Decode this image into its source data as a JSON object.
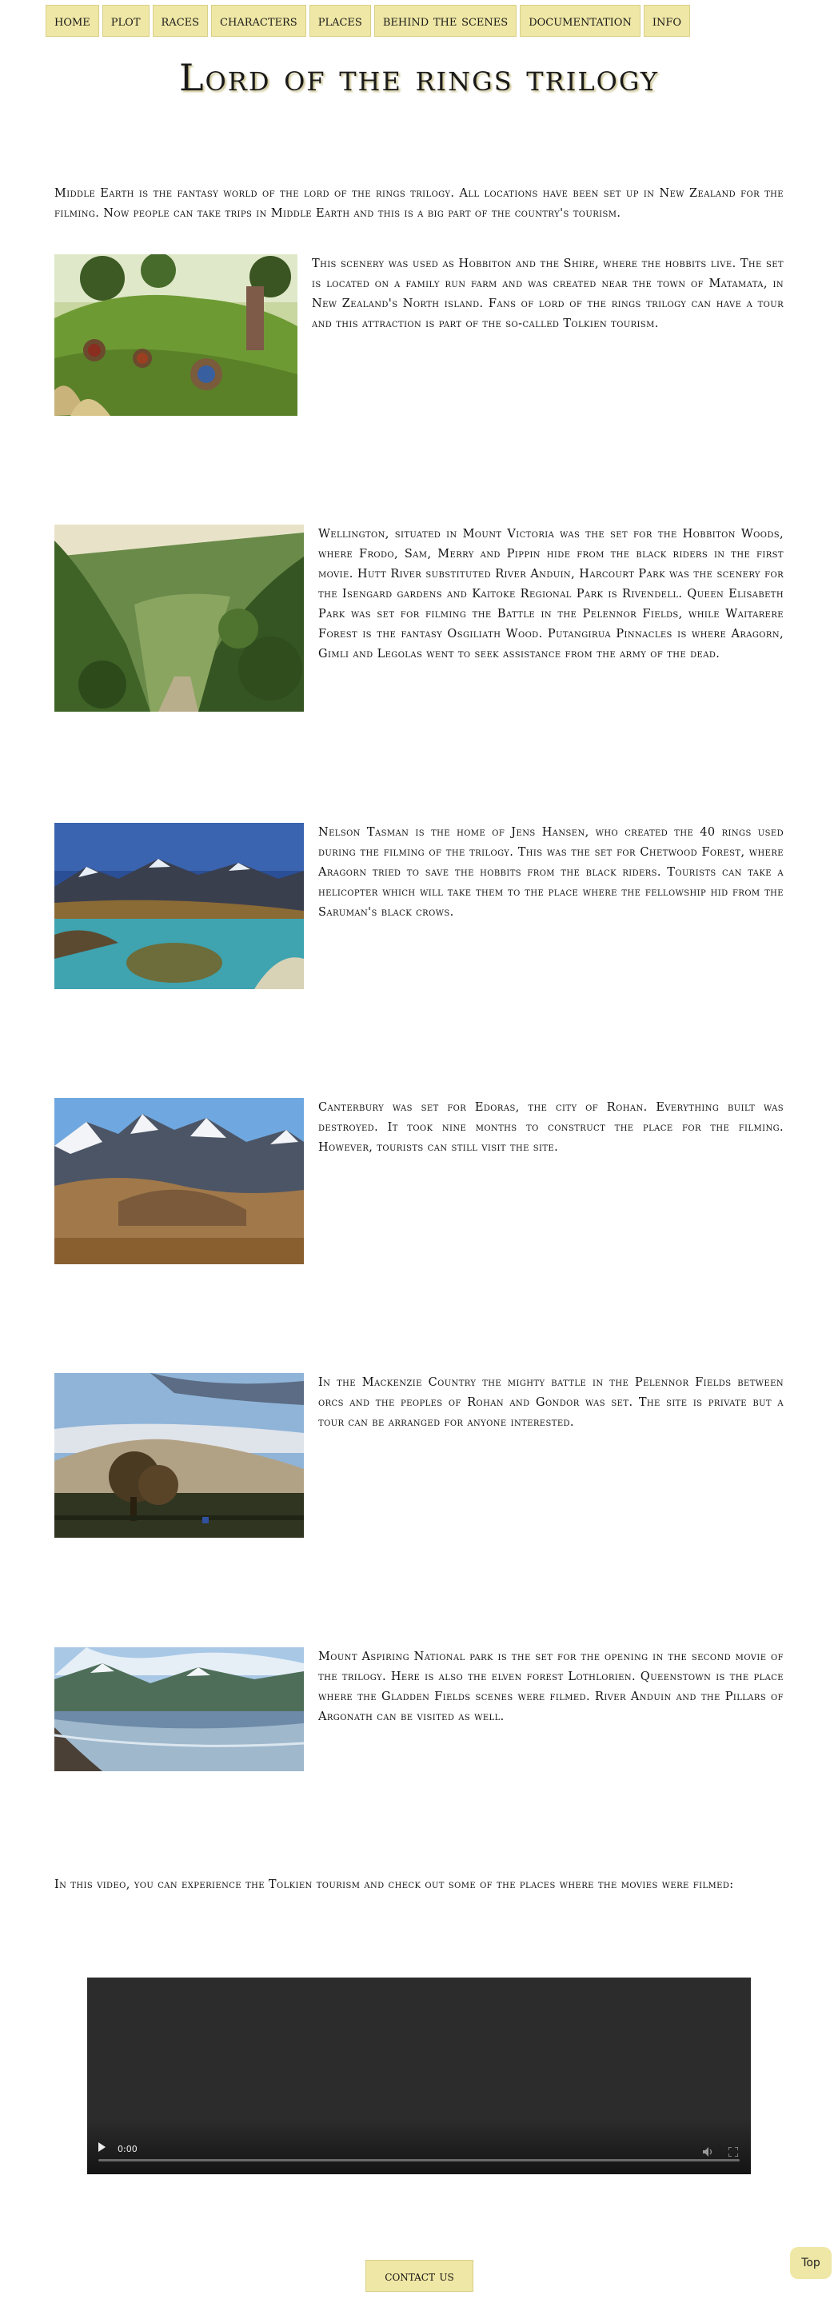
{
  "nav": {
    "items": [
      "home",
      "plot",
      "races",
      "characters",
      "places",
      "behind the scenes",
      "documentation",
      "info"
    ]
  },
  "header": {
    "title": "Lord of the rings trilogy"
  },
  "intro": "Middle Earth is the fantasy world of the lord of the rings trilogy. All locations have been set up in New Zealand for the filming. Now people can take trips in Middle Earth and this is a big part of the country's tourism.",
  "locations": [
    {
      "image": "hobbiton-image",
      "text": "This scenery was used as Hobbiton and the Shire, where the hobbits live. The set is located on a family run farm and was created near the town of Matamata, in New Zealand's North island. Fans of lord of the rings trilogy can have a tour and this attraction is part of the so-called Tolkien tourism."
    },
    {
      "image": "wellington-forest-image",
      "text": "Wellington, situated in Mount Victoria was the set for the Hobbiton Woods, where Frodo, Sam, Merry and Pippin hide from the black riders in the first movie. Hutt River substituted River Anduin, Harcourt Park was the scenery for the Isengard gardens and Kaitoke Regional Park is Rivendell. Queen Elisabeth Park was set for filming the Battle in the Pelennor Fields, while Waitarere Forest is the fantasy Osgiliath Wood. Putangirua Pinnacles is where Aragorn, Gimli and Legolas went to seek assistance from the army of the dead."
    },
    {
      "image": "nelson-tasman-image",
      "text": "Nelson Tasman is the home of Jens Hansen, who created the 40 rings used during the filming of the trilogy. This was the set for Chetwood Forest, where Aragorn tried to save the hobbits from the black riders. Tourists can take a helicopter which will take them to the place where the fellowship hid from the Saruman's black crows."
    },
    {
      "image": "canterbury-image",
      "text": "Canterbury was set for Edoras, the city of Rohan. Everything built was destroyed. It took nine months to construct the place for the filming. However, tourists can still visit the site."
    },
    {
      "image": "mackenzie-country-image",
      "text": "In the Mackenzie Country the mighty battle in the Pelennor Fields between orcs and the peoples of Rohan and Gondor was set. The site is private but a tour can be arranged for anyone interested."
    },
    {
      "image": "mount-aspiring-image",
      "text": "Mount Aspiring National park is the set for the opening in the second movie of the trilogy. Here is also the elven forest Lothlorien. Queenstown is the place where the Gladden Fields scenes were filmed. River Anduin and the Pillars of Argonath can be visited as well."
    }
  ],
  "video_section": {
    "intro": "In this video, you can experience the Tolkien tourism and check out some of the places where the movies were filmed:",
    "time": "0:00"
  },
  "footer": {
    "contact_label": "contact us",
    "top_label": "Top"
  }
}
